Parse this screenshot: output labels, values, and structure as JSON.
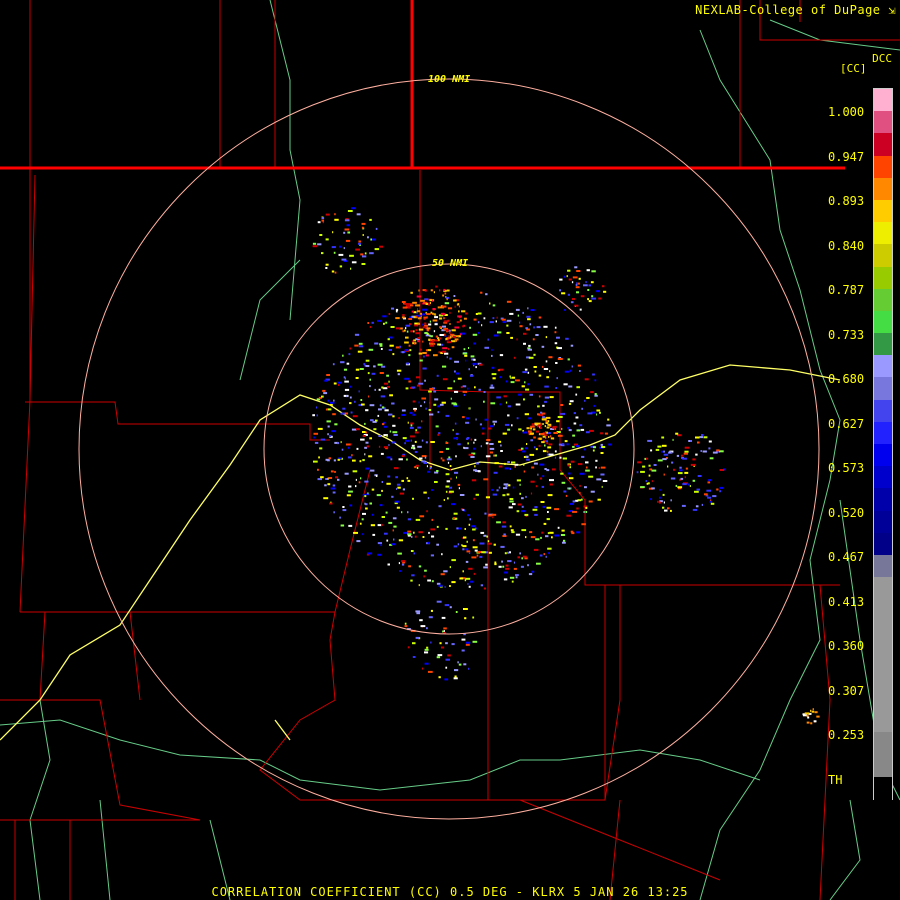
{
  "header": {
    "credit": "NEXLAB-College of DuPage",
    "site_id": "DCC"
  },
  "map": {
    "product": "CC",
    "range_rings": [
      {
        "label": "100 NMI"
      },
      {
        "label": "50 NMI"
      }
    ],
    "colors": {
      "county_lines": "#cc0000",
      "state_lines": "#ff0000",
      "highways": "#ffff66",
      "rivers": "#66cc88",
      "rings": "#ffb0a0"
    }
  },
  "colorbar": {
    "unit_label": "[CC]",
    "ticks": [
      "1.000",
      "0.947",
      "0.893",
      "0.840",
      "0.787",
      "0.733",
      "0.680",
      "0.627",
      "0.573",
      "0.520",
      "0.467",
      "0.413",
      "0.360",
      "0.307",
      "0.253",
      "TH"
    ],
    "colors": [
      "#ffb0d0",
      "#e05080",
      "#cc0022",
      "#ff4400",
      "#ff8800",
      "#ffcc00",
      "#eeee00",
      "#cccc00",
      "#99cc00",
      "#66cc33",
      "#44dd44",
      "#339944",
      "#9999ff",
      "#7777dd",
      "#4444ee",
      "#2222ff",
      "#0000ee",
      "#0000cc",
      "#0000aa",
      "#000099",
      "#000088",
      "#777799",
      "#999999",
      "#999999",
      "#999999",
      "#999999",
      "#999999",
      "#999999",
      "#999999",
      "#888888",
      "#888888",
      "#000000"
    ]
  },
  "footer": {
    "caption": "CORRELATION COEFFICIENT (CC) 0.5 DEG - KLRX 5 JAN 26 13:25"
  }
}
